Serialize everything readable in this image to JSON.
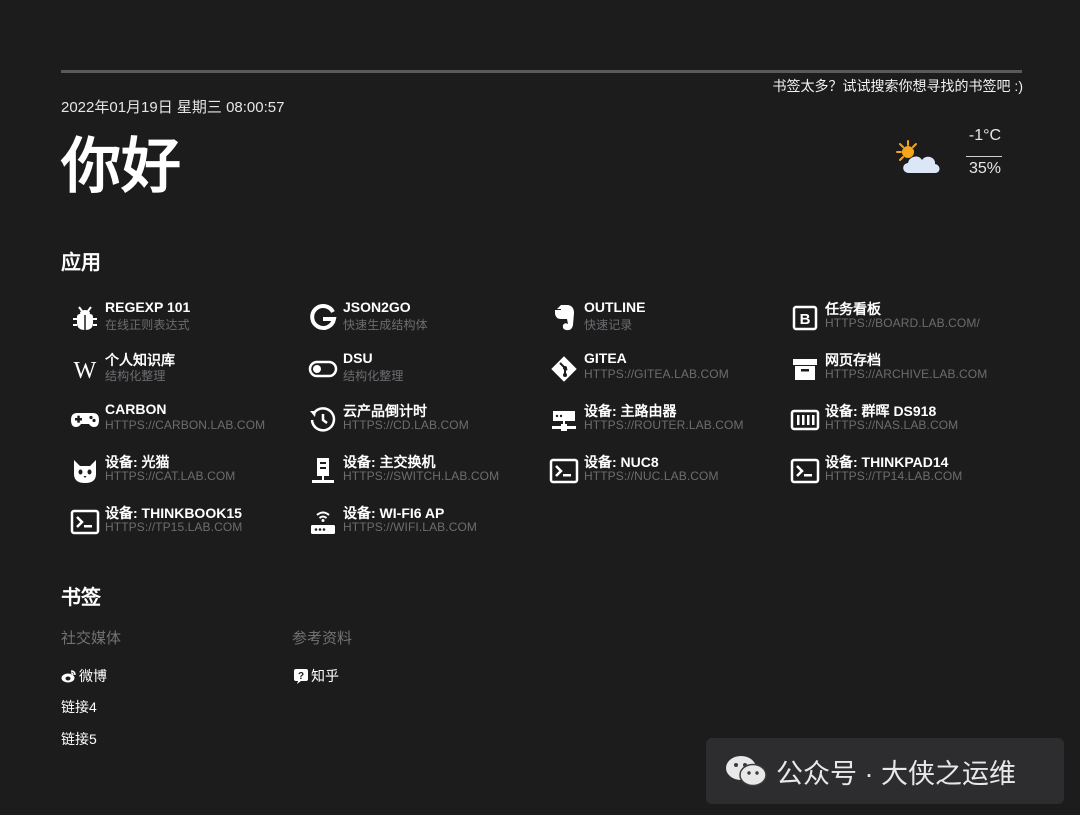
{
  "header": {
    "search_hint": "书签太多？试试搜索你想寻找的书签吧 :)",
    "datetime": "2022年01月19日 星期三 08:00:57",
    "greeting": "你好"
  },
  "weather": {
    "icon": "partly-cloudy-icon",
    "temperature": "-1°C",
    "humidity": "35%"
  },
  "apps": {
    "title": "应用",
    "items": [
      {
        "name": "REGEXP 101",
        "sub": "在线正则表达式",
        "icon": "bug-icon"
      },
      {
        "name": "JSON2GO",
        "sub": "快速生成结构体",
        "icon": "google-g-icon"
      },
      {
        "name": "OUTLINE",
        "sub": "快速记录",
        "icon": "evernote-icon"
      },
      {
        "name": "任务看板",
        "sub": "HTTPS://BOARD.LAB.COM/",
        "icon": "board-b-icon"
      },
      {
        "name": "个人知识库",
        "sub": "结构化整理",
        "icon": "wikipedia-icon"
      },
      {
        "name": "DSU",
        "sub": "结构化整理",
        "icon": "toggle-icon"
      },
      {
        "name": "GITEA",
        "sub": "HTTPS://GITEA.LAB.COM",
        "icon": "git-icon"
      },
      {
        "name": "网页存档",
        "sub": "HTTPS://ARCHIVE.LAB.COM",
        "icon": "archive-box-icon"
      },
      {
        "name": "CARBON",
        "sub": "HTTPS://CARBON.LAB.COM",
        "icon": "gamepad-icon"
      },
      {
        "name": "云产品倒计时",
        "sub": "HTTPS://CD.LAB.COM",
        "icon": "history-clock-icon"
      },
      {
        "name": "设备: 主路由器",
        "sub": "HTTPS://ROUTER.LAB.COM",
        "icon": "network-icon"
      },
      {
        "name": "设备: 群晖 DS918",
        "sub": "HTTPS://NAS.LAB.COM",
        "icon": "nas-drives-icon"
      },
      {
        "name": "设备: 光猫",
        "sub": "HTTPS://CAT.LAB.COM",
        "icon": "cat-icon"
      },
      {
        "name": "设备: 主交换机",
        "sub": "HTTPS://SWITCH.LAB.COM",
        "icon": "switch-tower-icon"
      },
      {
        "name": "设备: NUC8",
        "sub": "HTTPS://NUC.LAB.COM",
        "icon": "terminal-icon"
      },
      {
        "name": "设备: THINKPAD14",
        "sub": "HTTPS://TP14.LAB.COM",
        "icon": "terminal-icon"
      },
      {
        "name": "设备: THINKBOOK15",
        "sub": "HTTPS://TP15.LAB.COM",
        "icon": "terminal-icon"
      },
      {
        "name": "设备: WI-FI6 AP",
        "sub": "HTTPS://WIFI.LAB.COM",
        "icon": "wifi-router-icon"
      }
    ]
  },
  "bookmarks": {
    "title": "书签",
    "groups": [
      {
        "label": "社交媒体",
        "links": [
          {
            "label": "微博",
            "icon": "weibo-icon"
          },
          {
            "label": "链接4",
            "icon": ""
          },
          {
            "label": "链接5",
            "icon": ""
          }
        ]
      },
      {
        "label": "参考资料",
        "links": [
          {
            "label": "知乎",
            "icon": "zhihu-icon"
          }
        ]
      }
    ]
  },
  "watermark": {
    "text": "公众号 · 大侠之运维",
    "icon": "wechat-icon"
  }
}
